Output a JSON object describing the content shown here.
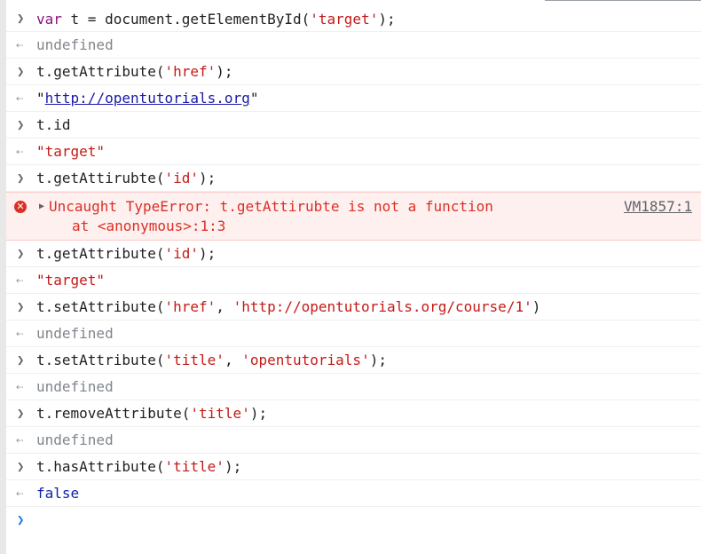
{
  "entries": [
    {
      "kind": "input",
      "parts": [
        {
          "t": "kw",
          "v": "var"
        },
        {
          "t": "plain",
          "v": " t = document.getElementById("
        },
        {
          "t": "str",
          "v": "'target'"
        },
        {
          "t": "plain",
          "v": ");"
        }
      ]
    },
    {
      "kind": "output",
      "text": "undefined",
      "style": "undef"
    },
    {
      "kind": "input",
      "parts": [
        {
          "t": "plain",
          "v": "t.getAttribute("
        },
        {
          "t": "str",
          "v": "'href'"
        },
        {
          "t": "plain",
          "v": ");"
        }
      ]
    },
    {
      "kind": "output-link",
      "prefix": "\"",
      "link": "http://opentutorials.org",
      "suffix": "\""
    },
    {
      "kind": "input",
      "parts": [
        {
          "t": "plain",
          "v": "t.id"
        }
      ]
    },
    {
      "kind": "output",
      "text": "\"target\"",
      "style": "str"
    },
    {
      "kind": "input",
      "parts": [
        {
          "t": "plain",
          "v": "t.getAttirubte("
        },
        {
          "t": "str",
          "v": "'id'"
        },
        {
          "t": "plain",
          "v": ");"
        }
      ]
    },
    {
      "kind": "error",
      "message": "Uncaught TypeError: t.getAttirubte is not a function",
      "stack": "at <anonymous>:1:3",
      "source": "VM1857:1"
    },
    {
      "kind": "input",
      "parts": [
        {
          "t": "plain",
          "v": "t.getAttribute("
        },
        {
          "t": "str",
          "v": "'id'"
        },
        {
          "t": "plain",
          "v": ");"
        }
      ]
    },
    {
      "kind": "output",
      "text": "\"target\"",
      "style": "str"
    },
    {
      "kind": "input",
      "parts": [
        {
          "t": "plain",
          "v": "t.setAttribute("
        },
        {
          "t": "str",
          "v": "'href'"
        },
        {
          "t": "plain",
          "v": ", "
        },
        {
          "t": "str",
          "v": "'http://opentutorials.org/course/1'"
        },
        {
          "t": "plain",
          "v": ")"
        }
      ]
    },
    {
      "kind": "output",
      "text": "undefined",
      "style": "undef"
    },
    {
      "kind": "input",
      "parts": [
        {
          "t": "plain",
          "v": "t.setAttribute("
        },
        {
          "t": "str",
          "v": "'title'"
        },
        {
          "t": "plain",
          "v": ", "
        },
        {
          "t": "str",
          "v": "'opentutorials'"
        },
        {
          "t": "plain",
          "v": ");"
        }
      ]
    },
    {
      "kind": "output",
      "text": "undefined",
      "style": "undef"
    },
    {
      "kind": "input",
      "parts": [
        {
          "t": "plain",
          "v": "t.removeAttribute("
        },
        {
          "t": "str",
          "v": "'title'"
        },
        {
          "t": "plain",
          "v": ");"
        }
      ]
    },
    {
      "kind": "output",
      "text": "undefined",
      "style": "undef"
    },
    {
      "kind": "input",
      "parts": [
        {
          "t": "plain",
          "v": "t.hasAttribute("
        },
        {
          "t": "str",
          "v": "'title'"
        },
        {
          "t": "plain",
          "v": ");"
        }
      ]
    },
    {
      "kind": "output",
      "text": "false",
      "style": "bool"
    }
  ],
  "icons": {
    "input_prompt": "chevron-right-icon",
    "result": "return-arrow-icon",
    "error": "error-circle-icon",
    "expand": "expand-triangle-icon",
    "active_prompt": "active-prompt-icon"
  },
  "colors": {
    "keyword": "#881280",
    "string": "#c41a16",
    "error_text": "#d93025",
    "error_bg": "#fff0f0",
    "bool": "#0d22aa",
    "undefined": "#80868b",
    "prompt_active": "#1a73e8"
  }
}
